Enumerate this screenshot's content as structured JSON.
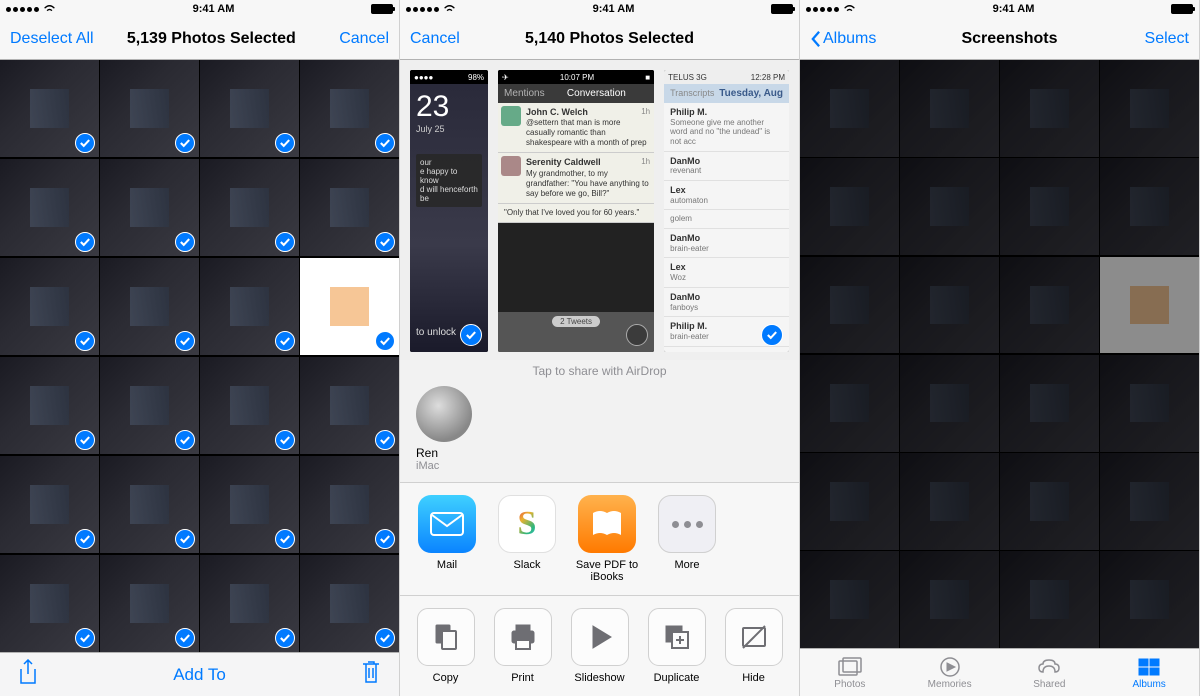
{
  "status": {
    "time": "9:41 AM"
  },
  "phone1": {
    "nav": {
      "left": "Deselect All",
      "title": "5,139 Photos Selected",
      "right": "Cancel"
    },
    "toolbar": {
      "center": "Add To"
    }
  },
  "phone2": {
    "nav": {
      "left": "Cancel",
      "title": "5,140 Photos Selected"
    },
    "airdrop": {
      "hint": "Tap to share with AirDrop",
      "name": "Ren",
      "device": "iMac"
    },
    "apps": [
      {
        "label": "Mail"
      },
      {
        "label": "Slack"
      },
      {
        "label": "Save PDF to iBooks"
      },
      {
        "label": "More"
      }
    ],
    "actions": [
      {
        "label": "Copy"
      },
      {
        "label": "Print"
      },
      {
        "label": "Slideshow"
      },
      {
        "label": "Duplicate"
      },
      {
        "label": "Hide"
      }
    ],
    "preview1": {
      "date_num": "23",
      "date_text": "July 25",
      "notif1": "our",
      "notif2": "e happy to know",
      "notif3": "d will henceforth be",
      "unlock": "to unlock"
    },
    "preview2": {
      "status_time": "10:07 PM",
      "tab_mentions": "Mentions",
      "title": "Conversation",
      "tweets": [
        {
          "name": "John C. Welch",
          "time": "1h",
          "text": "@settern that man is more casually romantic than shakespeare with a month of prep"
        },
        {
          "name": "Serenity Caldwell",
          "time": "1h",
          "text": "My grandmother, to my grandfather: \"You have anything to say before we go, Bill?\""
        },
        {
          "name": "",
          "time": "",
          "text": "\"Only that I've loved you for 60 years.\""
        }
      ],
      "footer": "2 Tweets"
    },
    "preview3": {
      "carrier": "TELUS 3G",
      "status_time": "12:28 PM",
      "tab_transcripts": "Transcripts",
      "header": "Tuesday, Aug",
      "rows": [
        {
          "name": "Philip M.",
          "sub": "Someone give me another word and no \"the undead\" is not acc"
        },
        {
          "name": "DanMo",
          "sub": "revenant"
        },
        {
          "name": "Lex",
          "sub": "automaton"
        },
        {
          "name": "",
          "sub": "golem"
        },
        {
          "name": "DanMo",
          "sub": "brain-eater"
        },
        {
          "name": "Lex",
          "sub": "Woz"
        },
        {
          "name": "DanMo",
          "sub": "fanboys"
        },
        {
          "name": "Philip M.",
          "sub": "brain-eater"
        }
      ]
    }
  },
  "phone3": {
    "nav": {
      "left": "Albums",
      "title": "Screenshots",
      "right": "Select"
    },
    "tabs": [
      {
        "label": "Photos"
      },
      {
        "label": "Memories"
      },
      {
        "label": "Shared"
      },
      {
        "label": "Albums"
      }
    ]
  }
}
